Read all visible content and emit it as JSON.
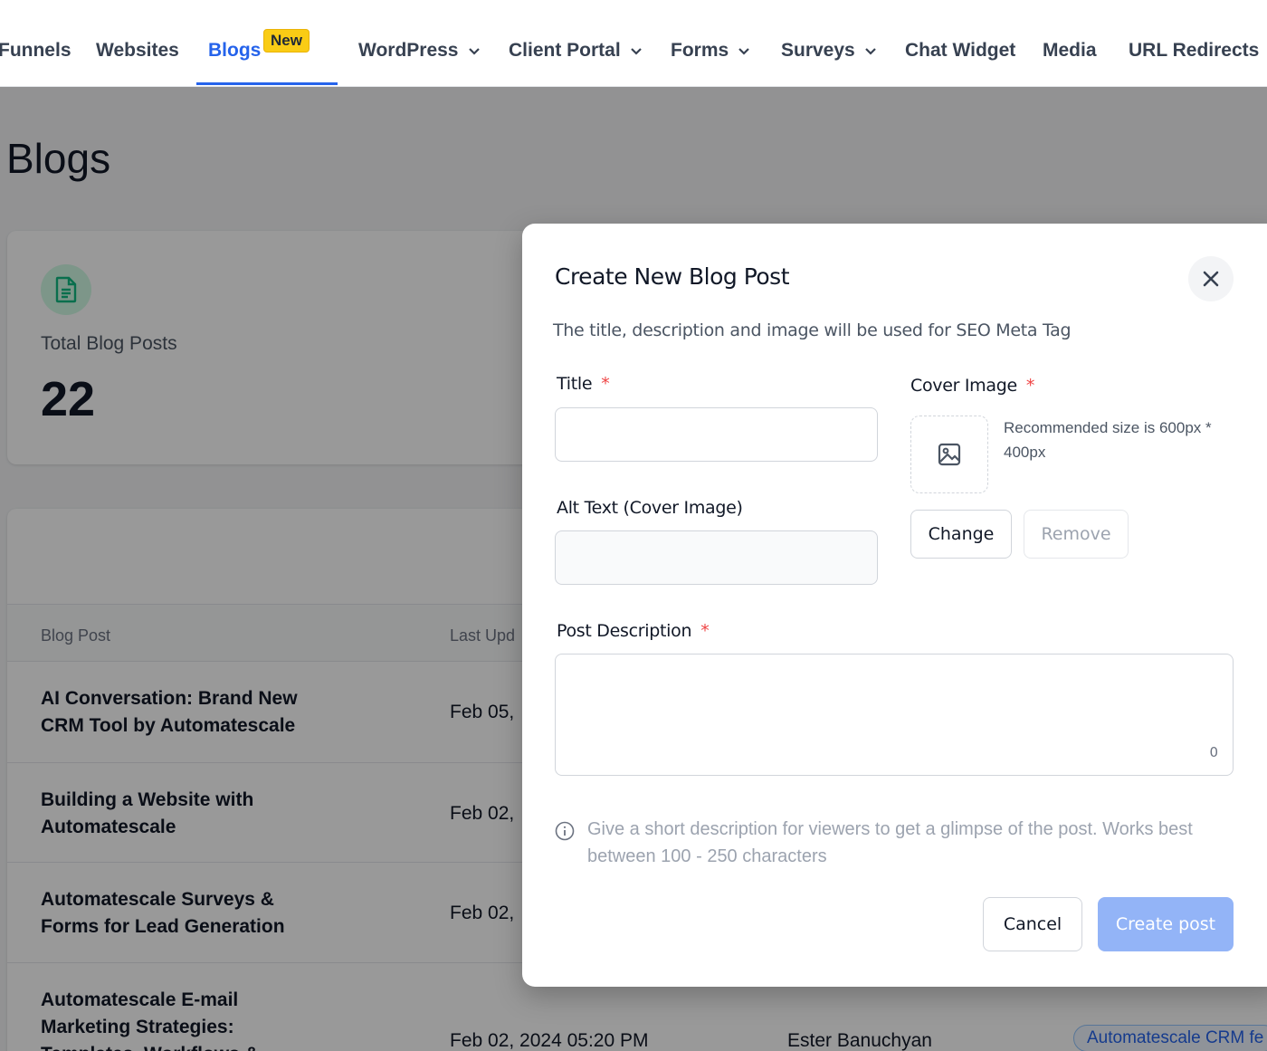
{
  "nav": {
    "items": [
      {
        "label": "Funnels"
      },
      {
        "label": "Websites"
      },
      {
        "label": "Blogs",
        "badge": "New"
      },
      {
        "label": "WordPress"
      },
      {
        "label": "Client Portal"
      },
      {
        "label": "Forms"
      },
      {
        "label": "Surveys"
      },
      {
        "label": "Chat Widget"
      },
      {
        "label": "Media"
      },
      {
        "label": "URL Redirects"
      }
    ]
  },
  "page": {
    "title": "Blogs"
  },
  "stats": {
    "label": "Total Blog Posts",
    "value": "22"
  },
  "table": {
    "headers": [
      "Blog Post",
      "Last Upd"
    ],
    "rows": [
      {
        "title": "AI Conversation: Brand New CRM Tool by Automatescale",
        "date": "Feb 05,"
      },
      {
        "title": "Building a Website with Automatescale",
        "date": "Feb 02,"
      },
      {
        "title": "Automatescale Surveys & Forms for Lead Generation",
        "date": "Feb 02,"
      },
      {
        "title": "Automatescale E-mail Marketing Strategies: Templates, Workflows &",
        "date": "Feb 02, 2024 05:20 PM",
        "author": "Ester Banuchyan",
        "tag": "Automatescale CRM fe"
      }
    ]
  },
  "modal": {
    "title": "Create New Blog Post",
    "subtitle": "The title, description and image will be used for SEO Meta Tag",
    "title_label": "Title",
    "required_mark": "*",
    "title_value": "",
    "alt_label": "Alt Text (Cover Image)",
    "alt_value": "",
    "cover_label": "Cover Image",
    "cover_hint": "Recommended size is 600px * 400px",
    "change_label": "Change",
    "remove_label": "Remove",
    "desc_label": "Post Description",
    "char_count": "0",
    "desc_hint": "Give a short description for viewers to get a glimpse of the post. Works best between 100 - 250 characters",
    "cancel_label": "Cancel",
    "create_label": "Create post"
  },
  "colors": {
    "accent": "#2563eb",
    "badge": "#facc15",
    "primary_disabled": "#93b4f7",
    "required": "#ef4444"
  }
}
